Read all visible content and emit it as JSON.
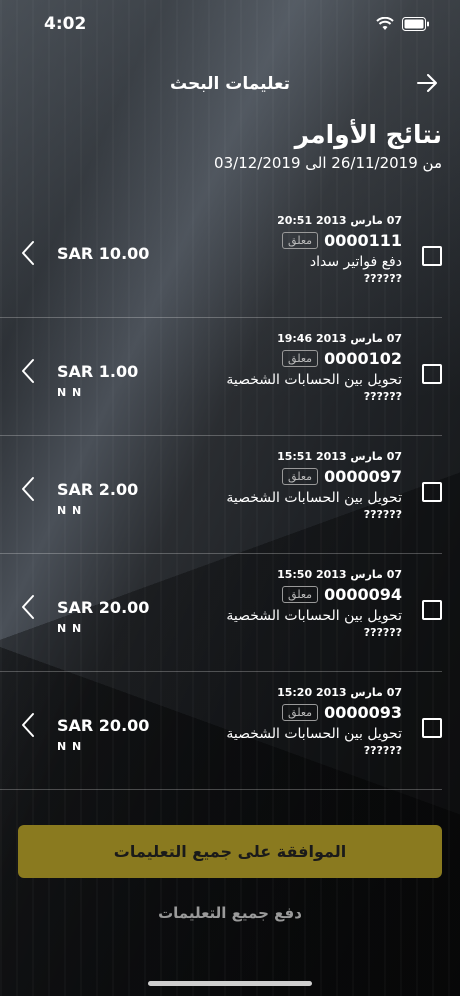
{
  "status_bar": {
    "time": "4:02"
  },
  "nav": {
    "title": "تعليمات البحث"
  },
  "header": {
    "title": "نتائج الأوامر",
    "date_range": "من 26/11/2019 الى 03/12/2019"
  },
  "rows": [
    {
      "datetime": "07 مارس 2013 20:51",
      "ref": "0000111",
      "status": "معلق",
      "description": "دفع فواتير سداد",
      "qm": "??????",
      "amount": "SAR 10.00",
      "account": ""
    },
    {
      "datetime": "07 مارس 2013 19:46",
      "ref": "0000102",
      "status": "معلق",
      "description": "تحويل بين الحسابات الشخصية",
      "qm": "??????",
      "amount": "SAR 1.00",
      "account": "N N"
    },
    {
      "datetime": "07 مارس 2013 15:51",
      "ref": "0000097",
      "status": "معلق",
      "description": "تحويل بين الحسابات الشخصية",
      "qm": "??????",
      "amount": "SAR 2.00",
      "account": "N N"
    },
    {
      "datetime": "07 مارس 2013 15:50",
      "ref": "0000094",
      "status": "معلق",
      "description": "تحويل بين الحسابات الشخصية",
      "qm": "??????",
      "amount": "SAR 20.00",
      "account": "N N"
    },
    {
      "datetime": "07 مارس 2013 15:20",
      "ref": "0000093",
      "status": "معلق",
      "description": "تحويل بين الحسابات الشخصية",
      "qm": "??????",
      "amount": "SAR 20.00",
      "account": "N N"
    }
  ],
  "actions": {
    "approve_all": "الموافقة على جميع التعليمات",
    "pay_all": "دفع جميع التعليمات"
  },
  "colors": {
    "accent": "#8a7a1f"
  }
}
